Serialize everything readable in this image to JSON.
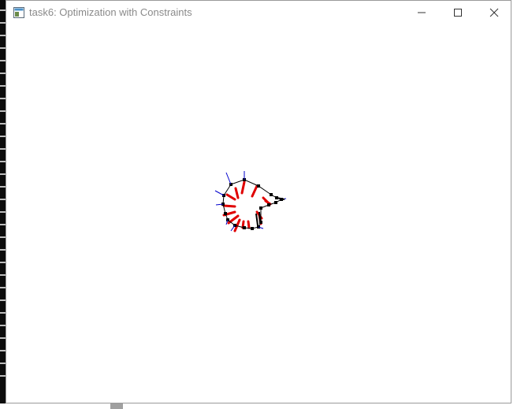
{
  "window": {
    "title": "task6: Optimization with Constraints",
    "icon": "app-window-icon",
    "controls": [
      "minimize-icon",
      "maximize-icon",
      "close-icon"
    ]
  },
  "colors": {
    "console_bg": "#0c0c0c",
    "title_text": "#8a8a8a",
    "outline": "#000000",
    "constraint_vectors": "#e00000",
    "normal_vectors": "#0000cc"
  }
}
